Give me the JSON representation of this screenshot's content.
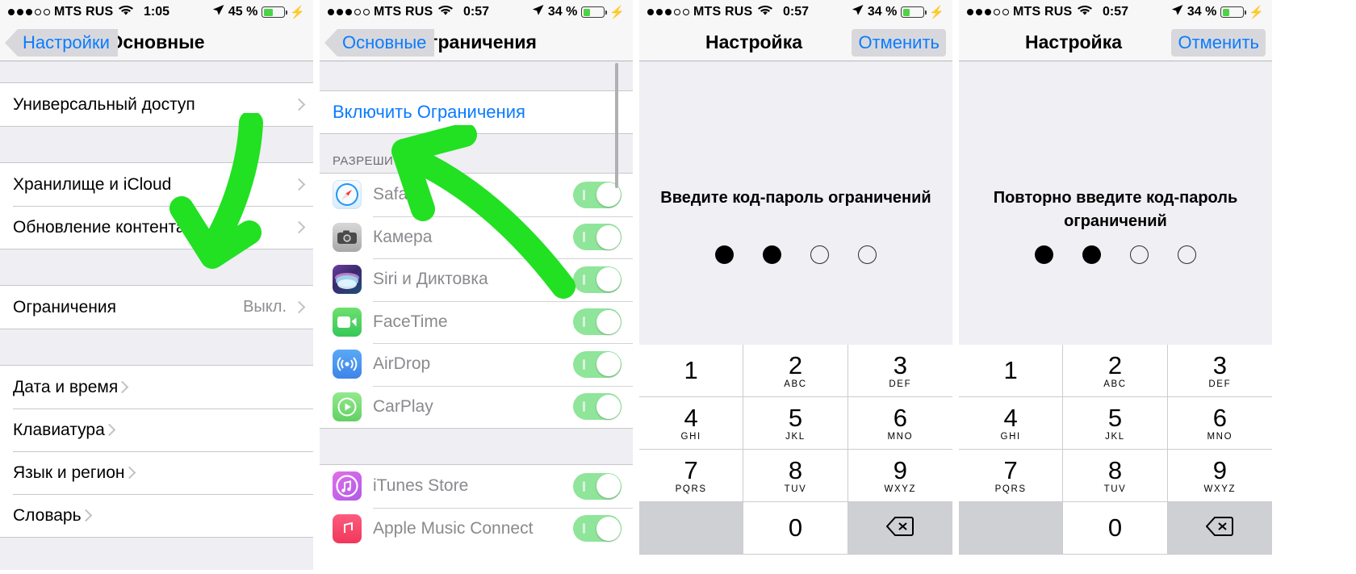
{
  "screens": [
    {
      "id": "general-settings",
      "status": {
        "carrier": "MTS RUS",
        "time": "1:05",
        "battery_pct": "45 %",
        "signal_filled": 3,
        "signal_empty": 2
      },
      "nav": {
        "back_label": "Настройки",
        "title": "Основные"
      },
      "rows": [
        {
          "label": "Универсальный доступ",
          "value": ""
        },
        {
          "label": "Хранилище и iCloud",
          "value": ""
        },
        {
          "label": "Обновление контента",
          "value": ""
        },
        {
          "label": "Ограничения",
          "value": "Выкл."
        },
        {
          "label": "Дата и время",
          "value": ""
        },
        {
          "label": "Клавиатура",
          "value": ""
        },
        {
          "label": "Язык и регион",
          "value": ""
        },
        {
          "label": "Словарь",
          "value": ""
        }
      ]
    },
    {
      "id": "restrictions",
      "status": {
        "carrier": "MTS RUS",
        "time": "0:57",
        "battery_pct": "34 %",
        "signal_filled": 3,
        "signal_empty": 2
      },
      "nav": {
        "back_label": "Основные",
        "title": "Ограничения"
      },
      "enable_link": "Включить Ограничения",
      "group_header": "РАЗРЕШИТЬ:",
      "apps": [
        {
          "name": "Safari",
          "icon": "safari-icon",
          "enabled": true
        },
        {
          "name": "Камера",
          "icon": "camera-icon",
          "enabled": true
        },
        {
          "name": "Siri и Диктовка",
          "icon": "siri-icon",
          "enabled": true
        },
        {
          "name": "FaceTime",
          "icon": "facetime-icon",
          "enabled": true
        },
        {
          "name": "AirDrop",
          "icon": "airdrop-icon",
          "enabled": true
        },
        {
          "name": "CarPlay",
          "icon": "carplay-icon",
          "enabled": true
        },
        {
          "name": "iTunes Store",
          "icon": "itunes-store-icon",
          "enabled": true
        },
        {
          "name": "Apple Music Connect",
          "icon": "apple-music-icon",
          "enabled": true
        }
      ]
    },
    {
      "id": "set-passcode",
      "status": {
        "carrier": "MTS RUS",
        "time": "0:57",
        "battery_pct": "34 %",
        "signal_filled": 3,
        "signal_empty": 2
      },
      "nav": {
        "title": "Настройка",
        "cancel_label": "Отменить"
      },
      "prompt": "Введите код-пароль ограничений",
      "dots_filled": 2,
      "dots_total": 4
    },
    {
      "id": "confirm-passcode",
      "status": {
        "carrier": "MTS RUS",
        "time": "0:57",
        "battery_pct": "34 %",
        "signal_filled": 3,
        "signal_empty": 2
      },
      "nav": {
        "title": "Настройка",
        "cancel_label": "Отменить"
      },
      "prompt": "Повторно введите код-пароль ограничений",
      "dots_filled": 2,
      "dots_total": 4
    }
  ],
  "keypad": [
    {
      "num": "1",
      "letters": ""
    },
    {
      "num": "2",
      "letters": "ABC"
    },
    {
      "num": "3",
      "letters": "DEF"
    },
    {
      "num": "4",
      "letters": "GHI"
    },
    {
      "num": "5",
      "letters": "JKL"
    },
    {
      "num": "6",
      "letters": "MNO"
    },
    {
      "num": "7",
      "letters": "PQRS"
    },
    {
      "num": "8",
      "letters": "TUV"
    },
    {
      "num": "9",
      "letters": "WXYZ"
    },
    {
      "num": "",
      "letters": ""
    },
    {
      "num": "0",
      "letters": ""
    },
    {
      "num": "delete-icon",
      "letters": ""
    }
  ],
  "annotation": {
    "color": "#22e022",
    "shape": "arrow"
  }
}
